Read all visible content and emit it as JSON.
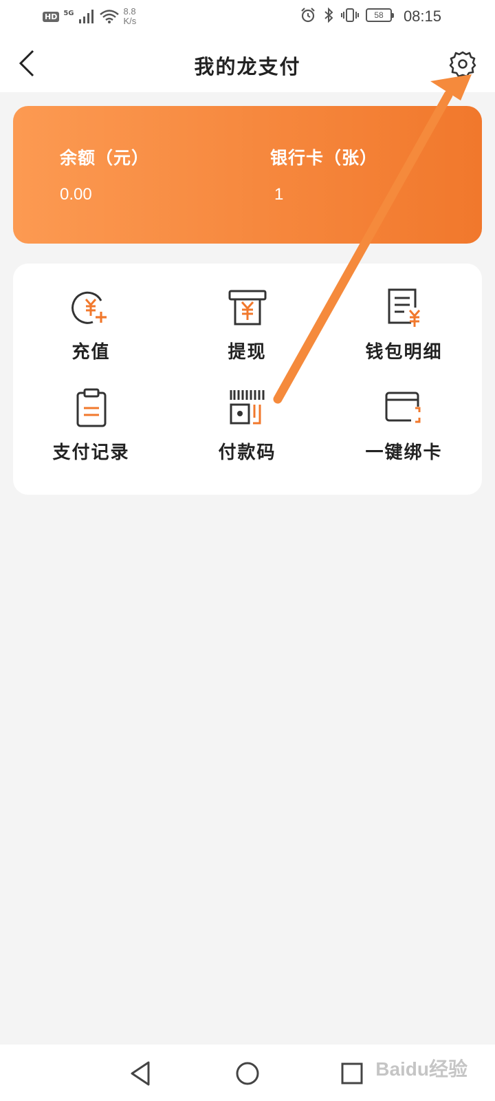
{
  "status_bar": {
    "hd": "HD",
    "network": "5G",
    "speed": "8.8 K/s",
    "battery": "58",
    "time": "08:15"
  },
  "header": {
    "title": "我的龙支付"
  },
  "balance_card": {
    "balance_label": "余额（元）",
    "balance_value": "0.00",
    "cards_label": "银行卡（张）",
    "cards_value": "1"
  },
  "services": [
    {
      "label": "充值",
      "icon": "recharge-icon"
    },
    {
      "label": "提现",
      "icon": "withdraw-icon"
    },
    {
      "label": "钱包明细",
      "icon": "wallet-detail-icon"
    },
    {
      "label": "支付记录",
      "icon": "payment-record-icon"
    },
    {
      "label": "付款码",
      "icon": "payment-code-icon"
    },
    {
      "label": "一键绑卡",
      "icon": "bind-card-icon"
    }
  ],
  "watermark": "Baidu经验",
  "colors": {
    "accent": "#f1782c",
    "accent_light": "#fc9a52",
    "arrow": "#f58a3c",
    "icon_dark": "#333333"
  }
}
